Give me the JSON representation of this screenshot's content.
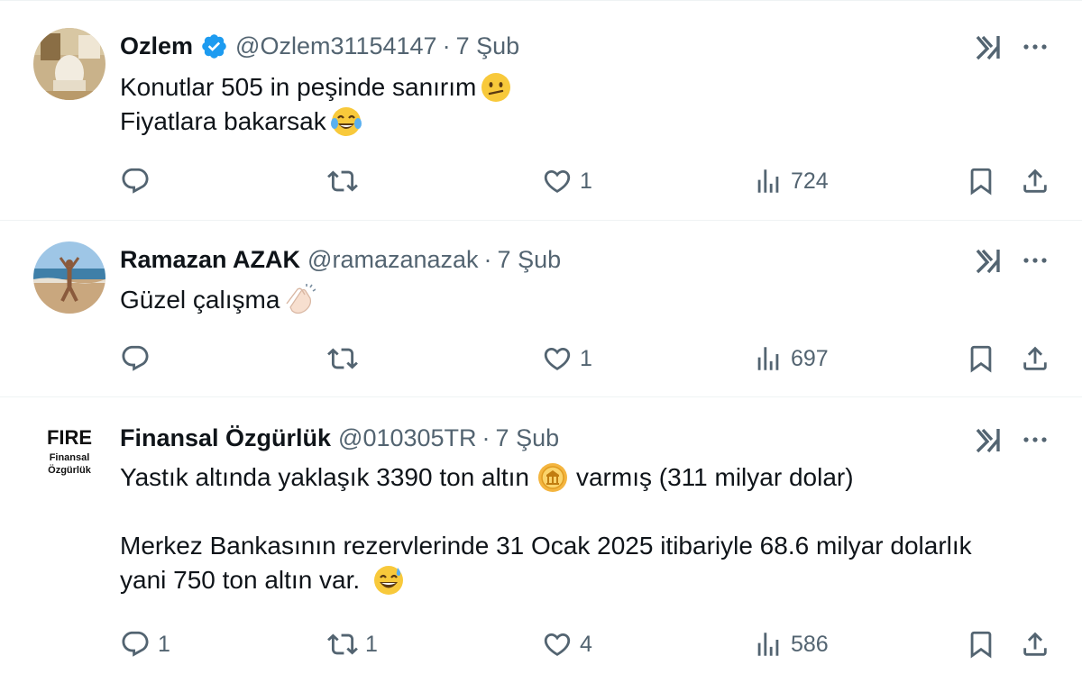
{
  "tweets": [
    {
      "name": "Ozlem",
      "verified": true,
      "handle": "@Ozlem31154147",
      "date": "7 Şub",
      "text_lines": [
        "Konutlar  505 in peşinde sanırım",
        "Fiyatlara bakarsak"
      ],
      "emojis": [
        "confused-face",
        "tears-of-joy"
      ],
      "replies": "",
      "retweets": "",
      "likes": "1",
      "views": "724"
    },
    {
      "name": "Ramazan AZAK",
      "verified": false,
      "handle": "@ramazanazak",
      "date": "7 Şub",
      "text_lines": [
        "Güzel çalışma"
      ],
      "emojis": [
        "clapping-hands"
      ],
      "replies": "",
      "retweets": "",
      "likes": "1",
      "views": "697"
    },
    {
      "name": "Finansal Özgürlük",
      "verified": false,
      "handle": "@010305TR",
      "date": "7 Şub",
      "avatar_text": [
        "FIRE",
        "Finansal",
        "Özgürlük"
      ],
      "text_lines": [
        "Yastık altında yaklaşık 3390 ton altın",
        "varmış (311 milyar dolar)",
        "",
        "Merkez Bankasının rezervlerinde 31 Ocak 2025 itibariyle 68.6 milyar dolarlık",
        "yani 750 ton altın var."
      ],
      "emojis": [
        "coin",
        "grinning-sweat"
      ],
      "replies": "1",
      "retweets": "1",
      "likes": "4",
      "views": "586"
    }
  ],
  "separator": "·",
  "icons": {
    "verified_color": "#1d9bf0",
    "muted_color": "#536471"
  }
}
